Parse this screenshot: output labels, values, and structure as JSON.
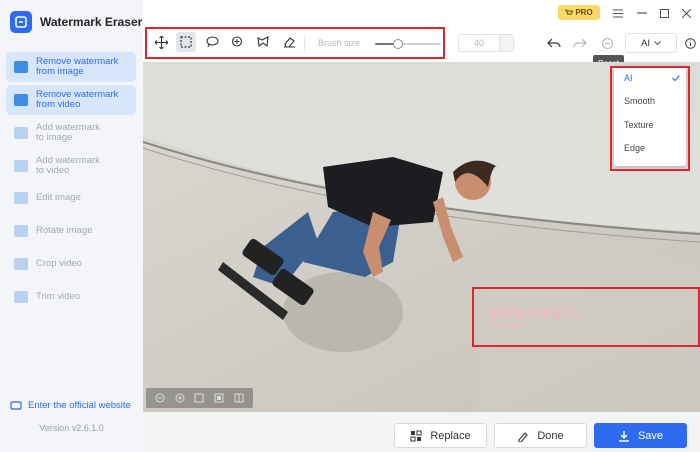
{
  "app": {
    "title": "Watermark Eraser",
    "version": "Version v2.6.1.0",
    "website_link": "Enter the official website"
  },
  "titlebar": {
    "pro_label": "PRO"
  },
  "sidebar": {
    "items": [
      {
        "label": "Remove watermark\nfrom image",
        "state": "active"
      },
      {
        "label": "Remove watermark\nfrom video",
        "state": "enabled"
      },
      {
        "label": "Add watermark\nto image",
        "state": "disabled"
      },
      {
        "label": "Add watermark\nto video",
        "state": "disabled"
      },
      {
        "label": "Edit image",
        "state": "disabled"
      },
      {
        "label": "Rotate image",
        "state": "disabled"
      },
      {
        "label": "Crop video",
        "state": "disabled"
      },
      {
        "label": "Trim video",
        "state": "disabled"
      }
    ]
  },
  "toolbar": {
    "tools": [
      "move-tool",
      "rectangle-select-tool",
      "lasso-tool",
      "smart-select-tool",
      "polygon-tool",
      "eraser-tool"
    ],
    "selected_tool": "rectangle-select-tool",
    "brush_size_label": "Brush size",
    "brush_size_value": "40",
    "brush_slider_fraction": 0.35,
    "model_selected": "AI",
    "reset_tooltip": "Reset"
  },
  "model_dropdown": {
    "options": [
      "AI",
      "Smooth",
      "Texture",
      "Edge"
    ],
    "selected": "AI"
  },
  "canvas": {
    "watermark_main": "getty",
    "watermark_sub": "images",
    "watermark_credit": "Caiaimage"
  },
  "actions": {
    "replace": "Replace",
    "done": "Done",
    "save": "Save"
  },
  "colors": {
    "accent": "#2f6bf0",
    "highlight_box": "#e0262d",
    "pro_badge": "#f7d96a"
  }
}
